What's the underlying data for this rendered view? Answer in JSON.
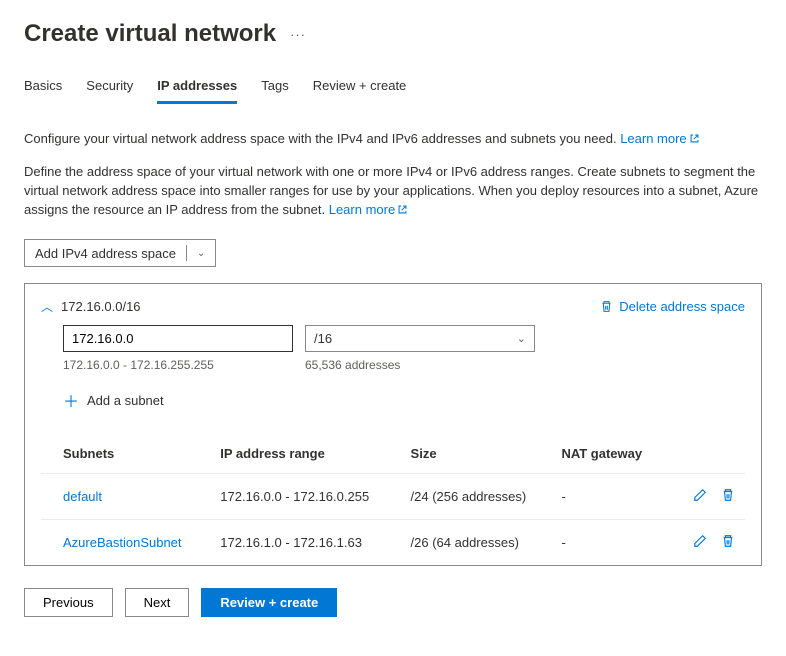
{
  "header": {
    "title": "Create virtual network"
  },
  "tabs": [
    "Basics",
    "Security",
    "IP addresses",
    "Tags",
    "Review + create"
  ],
  "activeTab": "IP addresses",
  "intro1_pre": "Configure your virtual network address space with the IPv4 and IPv6 addresses and subnets you need. ",
  "intro2_pre": "Define the address space of your virtual network with one or more IPv4 or IPv6 address ranges. Create subnets to segment the virtual network address space into smaller ranges for use by your applications. When you deploy resources into a subnet, Azure assigns the resource an IP address from the subnet. ",
  "learn_more": "Learn more",
  "add_space_btn": "Add IPv4 address space",
  "panel": {
    "cidr_title": "172.16.0.0/16",
    "delete_label": "Delete address space",
    "ip_input": "172.16.0.0",
    "cidr_select": "/16",
    "range_text": "172.16.0.0 - 172.16.255.255",
    "count_text": "65,536 addresses",
    "add_subnet": "Add a subnet"
  },
  "table": {
    "headers": [
      "Subnets",
      "IP address range",
      "Size",
      "NAT gateway"
    ],
    "rows": [
      {
        "name": "default",
        "range": "172.16.0.0 - 172.16.0.255",
        "size": "/24 (256 addresses)",
        "nat": "-"
      },
      {
        "name": "AzureBastionSubnet",
        "range": "172.16.1.0 - 172.16.1.63",
        "size": "/26 (64 addresses)",
        "nat": "-"
      }
    ]
  },
  "footer": {
    "prev": "Previous",
    "next": "Next",
    "review": "Review + create"
  }
}
